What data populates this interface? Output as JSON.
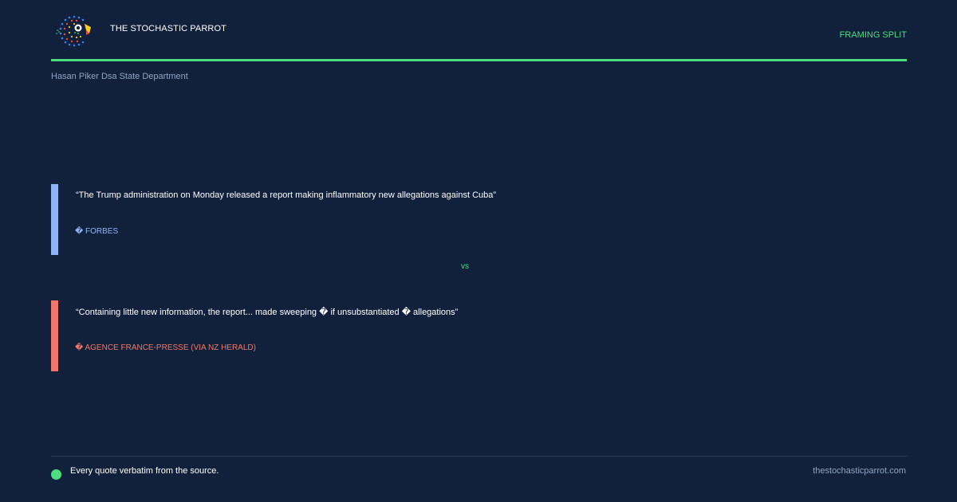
{
  "brand": {
    "name": "THE STOCHASTIC PARROT",
    "logo_icon": "parrot-logo-icon"
  },
  "header": {
    "section_label": "FRAMING SPLIT"
  },
  "topic": "Hasan Piker Dsa State Department",
  "quotes": [
    {
      "text": "“The Trump administration on Monday released a report making inflammatory new allegations against Cuba”",
      "source": "� FORBES",
      "accent": "#8fb4f5"
    },
    {
      "text": "“Containing little new information, the report... made sweeping � if unsubstantiated � allegations”",
      "source": "� AGENCE FRANCE-PRESSE (VIA NZ HERALD)",
      "accent": "#f0786b"
    }
  ],
  "vs_label": "vs",
  "footer": {
    "note": "Every quote verbatim from the source.",
    "url": "thestochasticparrot.com",
    "dot_icon": "green-dot-icon"
  },
  "colors": {
    "background": "#12213b",
    "accent_green": "#4ade80",
    "muted_text": "#8fa3c0"
  }
}
